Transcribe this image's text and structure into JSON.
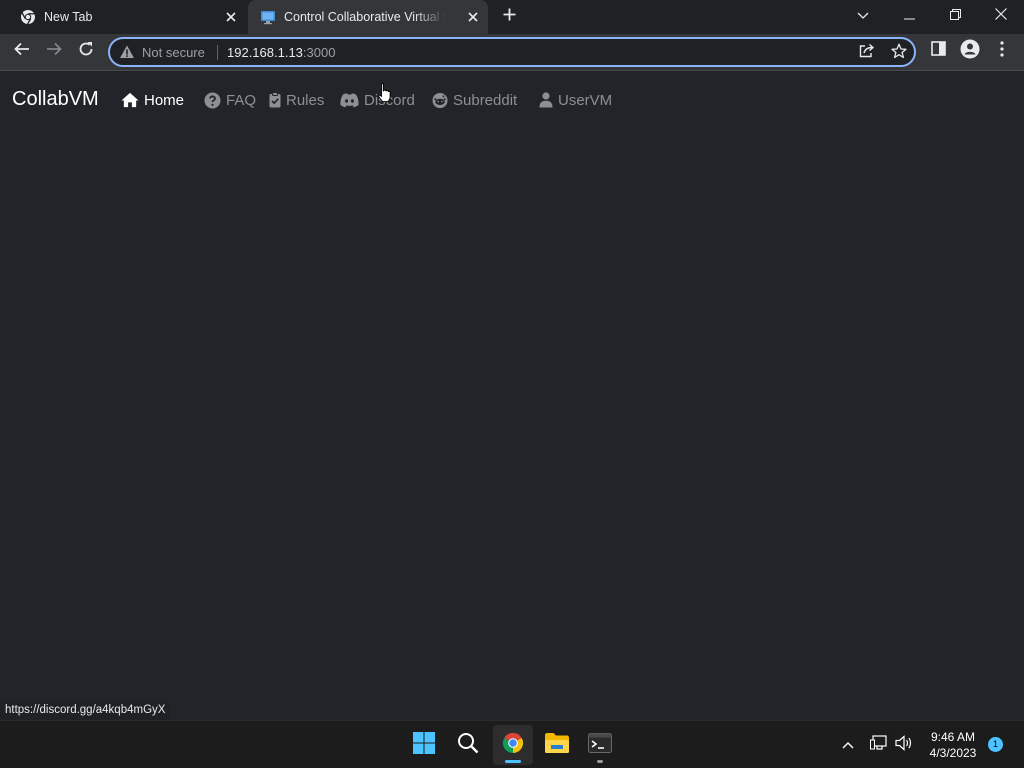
{
  "browser": {
    "tabs": [
      {
        "title": "New Tab",
        "active": false,
        "icon": "chrome-icon"
      },
      {
        "title": "Control Collaborative Virtual Machines",
        "active": true,
        "icon": "monitor-icon"
      }
    ],
    "address": {
      "security_label": "Not secure",
      "host": "192.168.1.13",
      "port": ":3000"
    },
    "status_url": "https://discord.gg/a4kqb4mGyX"
  },
  "site": {
    "brand": "CollabVM",
    "nav": [
      {
        "label": "Home",
        "icon": "home-icon",
        "active": true
      },
      {
        "label": "FAQ",
        "icon": "question-circle-icon",
        "active": false
      },
      {
        "label": "Rules",
        "icon": "clipboard-check-icon",
        "active": false
      },
      {
        "label": "Discord",
        "icon": "discord-icon",
        "active": false
      },
      {
        "label": "Subreddit",
        "icon": "reddit-icon",
        "active": false
      },
      {
        "label": "UserVM",
        "icon": "user-icon",
        "active": false
      }
    ]
  },
  "taskbar": {
    "apps": [
      "start-icon",
      "search-icon",
      "chrome-icon",
      "file-explorer-icon",
      "terminal-icon"
    ],
    "time": "9:46 AM",
    "date": "4/3/2023",
    "notification_count": "1"
  },
  "colors": {
    "accent": "#8ab4f8",
    "page_bg": "#212529",
    "taskbar_accent": "#4cc2ff"
  }
}
